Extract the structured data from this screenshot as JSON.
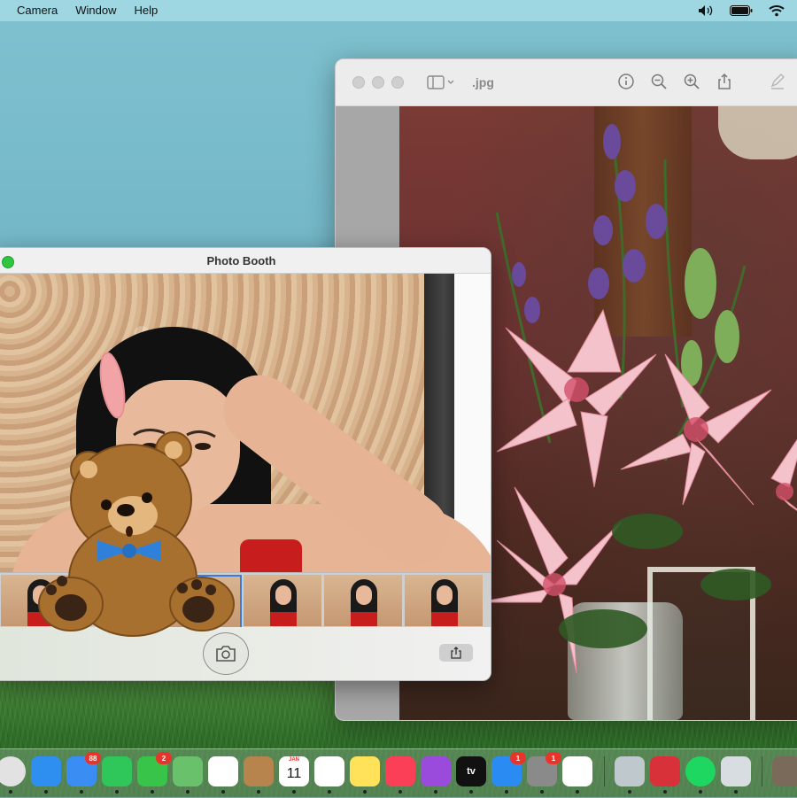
{
  "menubar": {
    "items": [
      "Camera",
      "Window",
      "Help"
    ]
  },
  "preview": {
    "title": ".jpg",
    "toolbar_icons": [
      "info-icon",
      "zoom-out-icon",
      "zoom-in-icon",
      "share-icon",
      "markup-icon"
    ]
  },
  "photobooth": {
    "title": "Photo Booth",
    "thumbnail_count": 5
  },
  "dock": {
    "apps": [
      {
        "name": "chrome-icon",
        "color": "#e2e2e2"
      },
      {
        "name": "safari-icon",
        "color": "#2f8ff0"
      },
      {
        "name": "mail-icon",
        "color": "#3a8df2",
        "badge": "88"
      },
      {
        "name": "facetime-icon",
        "color": "#2fc65a"
      },
      {
        "name": "messages-icon",
        "color": "#37c449",
        "badge": "2"
      },
      {
        "name": "maps-icon",
        "color": "#69c16b"
      },
      {
        "name": "photos-icon",
        "color": "#ffffff"
      },
      {
        "name": "contacts-icon",
        "color": "#b8844d"
      },
      {
        "name": "calendar-icon",
        "color": "#ffffff",
        "label_top": "JAN",
        "label": "11"
      },
      {
        "name": "reminders-icon",
        "color": "#ffffff"
      },
      {
        "name": "notes-icon",
        "color": "#ffe15a"
      },
      {
        "name": "music-icon",
        "color": "#fa3f57"
      },
      {
        "name": "podcasts-icon",
        "color": "#9a4bdc"
      },
      {
        "name": "tv-icon",
        "color": "#111111",
        "label": "tv"
      },
      {
        "name": "app-store-icon",
        "color": "#2a8cf2",
        "badge": "1"
      },
      {
        "name": "system-preferences-icon",
        "color": "#8a8a8a",
        "badge": "1"
      },
      {
        "name": "word-icon",
        "color": "#ffffff"
      },
      {
        "name": "quicktime-icon",
        "color": "#bfc8cc"
      },
      {
        "name": "photo-booth-icon",
        "color": "#d8313a"
      },
      {
        "name": "spotify-icon",
        "color": "#1ed760"
      },
      {
        "name": "preview-icon",
        "color": "#d8dde2"
      },
      {
        "name": "downloads-stack-icon",
        "color": "#7a6a5a"
      }
    ]
  }
}
